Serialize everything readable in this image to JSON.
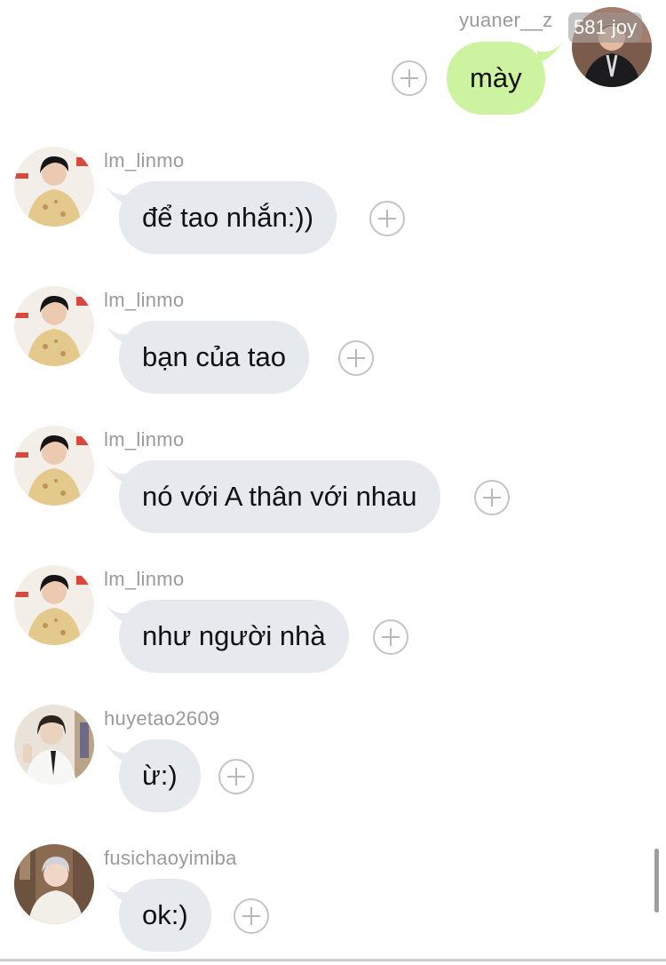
{
  "messages": [
    {
      "id": "m0",
      "sender": "yuaner__z",
      "text": "mày",
      "outgoing": true,
      "avatar_badge": "581 joy",
      "avatar_icon": "user-photo-dark"
    },
    {
      "id": "m1",
      "sender": "lm_linmo",
      "text": "để tao nhắn:))",
      "outgoing": false,
      "avatar_icon": "user-photo-beige"
    },
    {
      "id": "m2",
      "sender": "lm_linmo",
      "text": "bạn của tao",
      "outgoing": false,
      "avatar_icon": "user-photo-beige"
    },
    {
      "id": "m3",
      "sender": "lm_linmo",
      "text": "nó với A thân với nhau",
      "outgoing": false,
      "avatar_icon": "user-photo-beige"
    },
    {
      "id": "m4",
      "sender": "lm_linmo",
      "text": "như người nhà",
      "outgoing": false,
      "avatar_icon": "user-photo-beige"
    },
    {
      "id": "m5",
      "sender": "huyetao2609",
      "text": "ừ:)",
      "outgoing": false,
      "avatar_icon": "user-photo-light"
    },
    {
      "id": "m6",
      "sender": "fusichaoyimiba",
      "text": "ok:)",
      "outgoing": false,
      "avatar_icon": "user-photo-brown"
    }
  ],
  "colors": {
    "incoming_bubble": "#e6e9ee",
    "outgoing_bubble": "#cdf2a0",
    "username": "#9a9a9a",
    "text": "#111111"
  },
  "icons": {
    "add_reaction": "plus-circle-icon"
  }
}
